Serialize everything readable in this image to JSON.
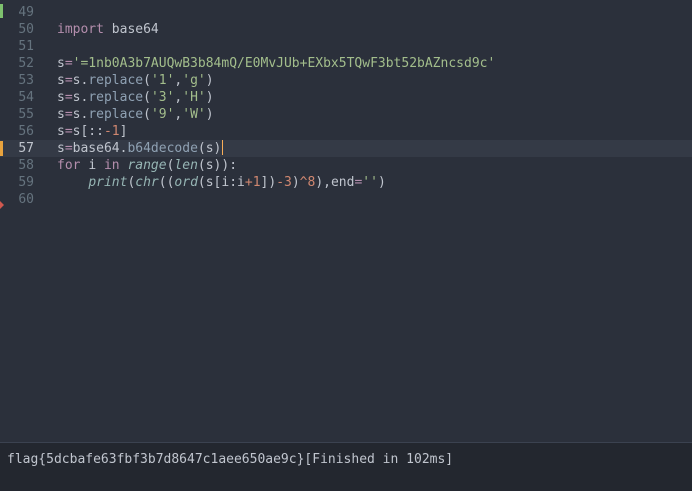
{
  "editor": {
    "lines": [
      {
        "n": "49",
        "tokens": []
      },
      {
        "n": "50",
        "tokens": [
          {
            "t": "import ",
            "c": "kw"
          },
          {
            "t": "base64",
            "c": "op"
          }
        ]
      },
      {
        "n": "51",
        "tokens": []
      },
      {
        "n": "52",
        "tokens": [
          {
            "t": "s",
            "c": "op"
          },
          {
            "t": "=",
            "c": "kw"
          },
          {
            "t": "'=1nb0A3b7AUQwB3b84mQ/E0MvJUb+EXbx5TQwF3bt52bAZncsd9c'",
            "c": "str"
          }
        ]
      },
      {
        "n": "53",
        "tokens": [
          {
            "t": "s",
            "c": "op"
          },
          {
            "t": "=",
            "c": "kw"
          },
          {
            "t": "s.",
            "c": "op"
          },
          {
            "t": "replace",
            "c": "fn"
          },
          {
            "t": "(",
            "c": "op"
          },
          {
            "t": "'1'",
            "c": "str"
          },
          {
            "t": ",",
            "c": "op"
          },
          {
            "t": "'g'",
            "c": "str"
          },
          {
            "t": ")",
            "c": "op"
          }
        ]
      },
      {
        "n": "54",
        "tokens": [
          {
            "t": "s",
            "c": "op"
          },
          {
            "t": "=",
            "c": "kw"
          },
          {
            "t": "s.",
            "c": "op"
          },
          {
            "t": "replace",
            "c": "fn"
          },
          {
            "t": "(",
            "c": "op"
          },
          {
            "t": "'3'",
            "c": "str"
          },
          {
            "t": ",",
            "c": "op"
          },
          {
            "t": "'H'",
            "c": "str"
          },
          {
            "t": ")",
            "c": "op"
          }
        ]
      },
      {
        "n": "55",
        "tokens": [
          {
            "t": "s",
            "c": "op"
          },
          {
            "t": "=",
            "c": "kw"
          },
          {
            "t": "s.",
            "c": "op"
          },
          {
            "t": "replace",
            "c": "fn"
          },
          {
            "t": "(",
            "c": "op"
          },
          {
            "t": "'9'",
            "c": "str"
          },
          {
            "t": ",",
            "c": "op"
          },
          {
            "t": "'W'",
            "c": "str"
          },
          {
            "t": ")",
            "c": "op"
          }
        ]
      },
      {
        "n": "56",
        "tokens": [
          {
            "t": "s",
            "c": "op"
          },
          {
            "t": "=",
            "c": "kw"
          },
          {
            "t": "s[::",
            "c": "op"
          },
          {
            "t": "-1",
            "c": "num"
          },
          {
            "t": "]",
            "c": "op"
          }
        ]
      },
      {
        "n": "57",
        "current": true,
        "cursor": true,
        "tokens": [
          {
            "t": "s",
            "c": "op"
          },
          {
            "t": "=",
            "c": "kw"
          },
          {
            "t": "base64.",
            "c": "op"
          },
          {
            "t": "b64decode",
            "c": "fn"
          },
          {
            "t": "(s)",
            "c": "op"
          }
        ]
      },
      {
        "n": "58",
        "tokens": [
          {
            "t": "for ",
            "c": "kw"
          },
          {
            "t": "i ",
            "c": "op"
          },
          {
            "t": "in ",
            "c": "kw"
          },
          {
            "t": "range",
            "c": "bi"
          },
          {
            "t": "(",
            "c": "op"
          },
          {
            "t": "len",
            "c": "bi"
          },
          {
            "t": "(s)):",
            "c": "op"
          }
        ]
      },
      {
        "n": "59",
        "tokens": [
          {
            "t": "    ",
            "c": "op"
          },
          {
            "t": "print",
            "c": "bi"
          },
          {
            "t": "(",
            "c": "op"
          },
          {
            "t": "chr",
            "c": "bi"
          },
          {
            "t": "((",
            "c": "op"
          },
          {
            "t": "ord",
            "c": "bi"
          },
          {
            "t": "(s[i:i",
            "c": "op"
          },
          {
            "t": "+1",
            "c": "num"
          },
          {
            "t": "])",
            "c": "op"
          },
          {
            "t": "-3",
            "c": "num"
          },
          {
            "t": ")",
            "c": "op"
          },
          {
            "t": "^8",
            "c": "num"
          },
          {
            "t": "),end",
            "c": "op"
          },
          {
            "t": "=",
            "c": "kw"
          },
          {
            "t": "''",
            "c": "str"
          },
          {
            "t": ")",
            "c": "op"
          }
        ]
      },
      {
        "n": "60",
        "tokens": []
      }
    ]
  },
  "output": {
    "text": "flag{5dcbafe63fbf3b7d8647c1aee650ae9c}[Finished in 102ms]"
  },
  "colors": {
    "background": "#2b303b",
    "keyword": "#b48ead",
    "string": "#a3be8c",
    "number": "#d08770",
    "function": "#8fa1b3",
    "builtin": "#96b5b4",
    "text": "#c0c5ce",
    "cursor": "#f9ae58"
  }
}
